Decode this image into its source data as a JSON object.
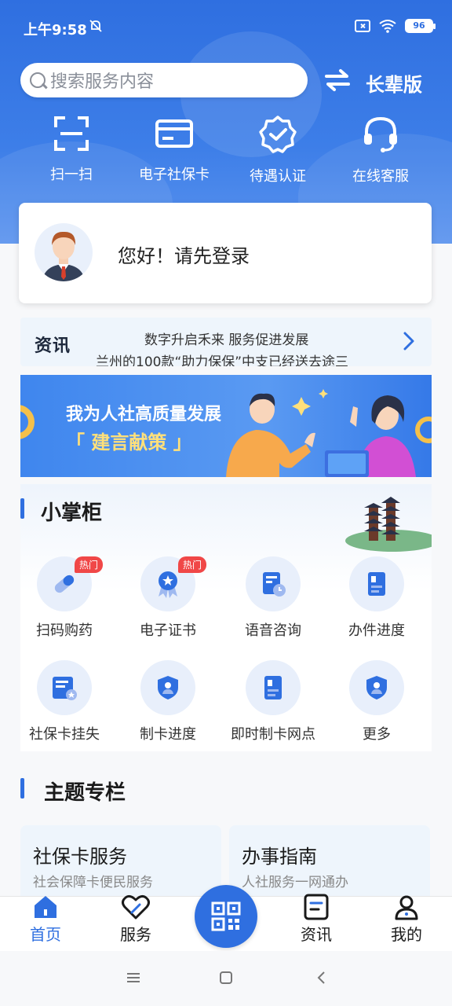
{
  "status": {
    "time": "上午9:58",
    "battery": "96"
  },
  "header": {
    "search_placeholder": "搜索服务内容",
    "elder_mode": "长辈版",
    "quick_actions": [
      {
        "label": "扫一扫",
        "icon": "scan-icon"
      },
      {
        "label": "电子社保卡",
        "icon": "card-icon"
      },
      {
        "label": "待遇认证",
        "icon": "verify-badge-icon"
      },
      {
        "label": "在线客服",
        "icon": "headset-icon"
      }
    ]
  },
  "login": {
    "greeting": "您好！请先登录"
  },
  "news": {
    "tag": "资讯",
    "line1": "数字升启禾来 服务促进发展",
    "line2": "兰州的100款“助力保保”中支已经送去途三"
  },
  "banner": {
    "title": "我为人社高质量发展",
    "subtitle": "「 建言献策 」"
  },
  "section_services": {
    "title": "小掌柜",
    "items": [
      {
        "label": "扫码购药",
        "badge": "热门",
        "icon": "pill-icon"
      },
      {
        "label": "电子证书",
        "badge": "热门",
        "icon": "certificate-icon"
      },
      {
        "label": "语音咨询",
        "badge": "",
        "icon": "document-clock-icon"
      },
      {
        "label": "办件进度",
        "badge": "",
        "icon": "progress-doc-icon"
      },
      {
        "label": "社保卡挂失",
        "badge": "",
        "icon": "card-report-icon"
      },
      {
        "label": "制卡进度",
        "badge": "",
        "icon": "shield-user-icon"
      },
      {
        "label": "即时制卡网点",
        "badge": "",
        "icon": "id-doc-icon"
      },
      {
        "label": "更多",
        "badge": "",
        "icon": "shield-more-icon"
      }
    ]
  },
  "section_themes": {
    "title": "主题专栏",
    "cards": [
      {
        "title": "社保卡服务",
        "subtitle": "社会保障卡便民服务"
      },
      {
        "title": "办事指南",
        "subtitle": "人社服务一网通办"
      }
    ]
  },
  "tabbar": {
    "items": [
      {
        "label": "首页",
        "active": true
      },
      {
        "label": "服务",
        "active": false
      },
      {
        "label": "资讯",
        "active": false
      },
      {
        "label": "我的",
        "active": false
      }
    ]
  },
  "colors": {
    "primary": "#2f6fe0",
    "hot": "#f04747",
    "banner_accent": "#ffe07a"
  }
}
